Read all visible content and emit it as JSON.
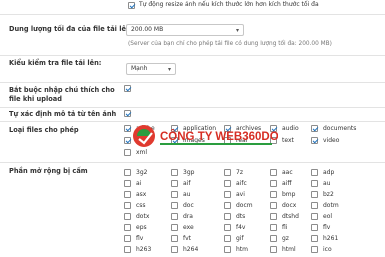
{
  "top_note": "Tự động resize ảnh nếu kích thước lớn hơn kích thước tối đa",
  "max_size": {
    "label": "Dung lượng tối đa của file tải lên:",
    "value": "200.00 MB",
    "note": "(Server của bạn chỉ cho phép tải file có dung lượng tối đa: 200.00 MB)"
  },
  "check_type": {
    "label": "Kiểu kiểm tra file tải lên:",
    "value": "Mạnh"
  },
  "require_note": {
    "label": "Bắt buộc nhập chú thích cho file khi upload",
    "checked": true
  },
  "auto_alt": {
    "label": "Tự xác định mô tả từ tên ảnh",
    "checked": true
  },
  "file_types": {
    "label": "Loại files cho phép",
    "items": [
      {
        "name": "adobe",
        "checked": true
      },
      {
        "name": "application",
        "checked": true
      },
      {
        "name": "archives",
        "checked": true
      },
      {
        "name": "audio",
        "checked": true
      },
      {
        "name": "documents",
        "checked": true
      },
      {
        "name": "flash",
        "checked": true
      },
      {
        "name": "images",
        "checked": true
      },
      {
        "name": "real",
        "checked": false
      },
      {
        "name": "text",
        "checked": false
      },
      {
        "name": "video",
        "checked": true
      },
      {
        "name": "xml",
        "checked": false
      }
    ]
  },
  "forbidden_ext": {
    "label": "Phần mở rộng bị cấm",
    "items": [
      "3g2",
      "3gp",
      "7z",
      "aac",
      "adp",
      "ai",
      "aif",
      "aifc",
      "aiff",
      "au",
      "asx",
      "au",
      "avi",
      "bmp",
      "bz2",
      "css",
      "doc",
      "docm",
      "docx",
      "dotm",
      "dotx",
      "dra",
      "dts",
      "dtshd",
      "eol",
      "eps",
      "exe",
      "f4v",
      "fli",
      "flv",
      "flv",
      "fvt",
      "gif",
      "gz",
      "h261",
      "h263",
      "h264",
      "htm",
      "html",
      "ico"
    ],
    "checked": false
  },
  "watermark": "CÔNG TY WEB360DO"
}
